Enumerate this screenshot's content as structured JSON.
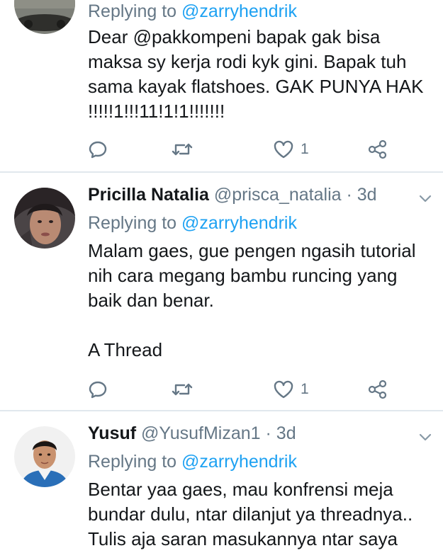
{
  "tweets": [
    {
      "reply_prefix": "Replying to",
      "reply_to": "@zarryhendrik",
      "text": "Dear @pakkompeni bapak gak bisa maksa sy kerja rodi kyk gini. Bapak tuh sama kayak flatshoes. GAK PUNYA HAK !!!!!1!!!11!1!1!!!!!!!",
      "likes": "1"
    },
    {
      "name": "Pricilla Natalia",
      "handle": "@prisca_natalia",
      "dot": "·",
      "time": "3d",
      "reply_prefix": "Replying to",
      "reply_to": "@zarryhendrik",
      "text": "Malam gaes, gue pengen ngasih tutorial nih cara megang bambu runcing yang baik dan benar.\n\nA Thread",
      "likes": "1"
    },
    {
      "name": "Yusuf",
      "handle": "@YusufMizan1",
      "dot": "·",
      "time": "3d",
      "reply_prefix": "Replying to",
      "reply_to": "@zarryhendrik",
      "text": "Bentar yaa gaes, mau konfrensi meja bundar dulu, ntar dilanjut ya threadnya.. Tulis aja saran masukannya ntar saya"
    }
  ],
  "icons": {
    "reply": "reply-icon",
    "retweet": "retweet-icon",
    "like": "heart-icon",
    "share": "share-icon",
    "menu": "chevron-down-icon"
  },
  "colors": {
    "link": "#1da1f2",
    "secondary": "#657786",
    "text": "#14171a",
    "divider": "#e1e8ed"
  }
}
